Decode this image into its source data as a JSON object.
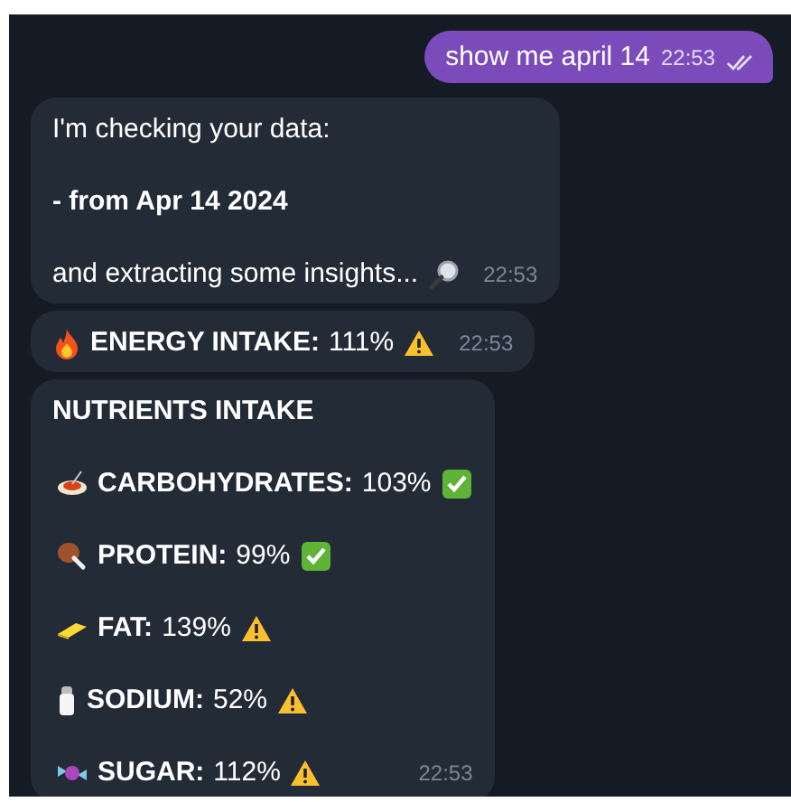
{
  "messages": [
    {
      "kind": "outgoing",
      "text": "show me april 14",
      "time": "22:53",
      "read": true
    },
    {
      "kind": "paragraphs",
      "paragraphs": [
        {
          "text": "I'm checking your data:",
          "bold": false
        },
        {
          "text": "- from Apr 14 2024",
          "bold": true
        },
        {
          "text": "and extracting some insights...",
          "bold": false
        }
      ],
      "time": "22:53"
    },
    {
      "kind": "metric",
      "label": "ENERGY INTAKE:",
      "value": "111%",
      "on_target": false,
      "time": "22:53"
    },
    {
      "kind": "list",
      "title": "NUTRIENTS INTAKE",
      "items": [
        {
          "label": "CARBOHYDRATES:",
          "value": "103%",
          "on_target": true
        },
        {
          "label": "PROTEIN:",
          "value": "99%",
          "on_target": true
        },
        {
          "label": "FAT:",
          "value": "139%",
          "on_target": false
        },
        {
          "label": "SODIUM:",
          "value": "52%",
          "on_target": false
        },
        {
          "label": "SUGAR:",
          "value": "112%",
          "on_target": false
        }
      ],
      "time": "22:53"
    }
  ]
}
